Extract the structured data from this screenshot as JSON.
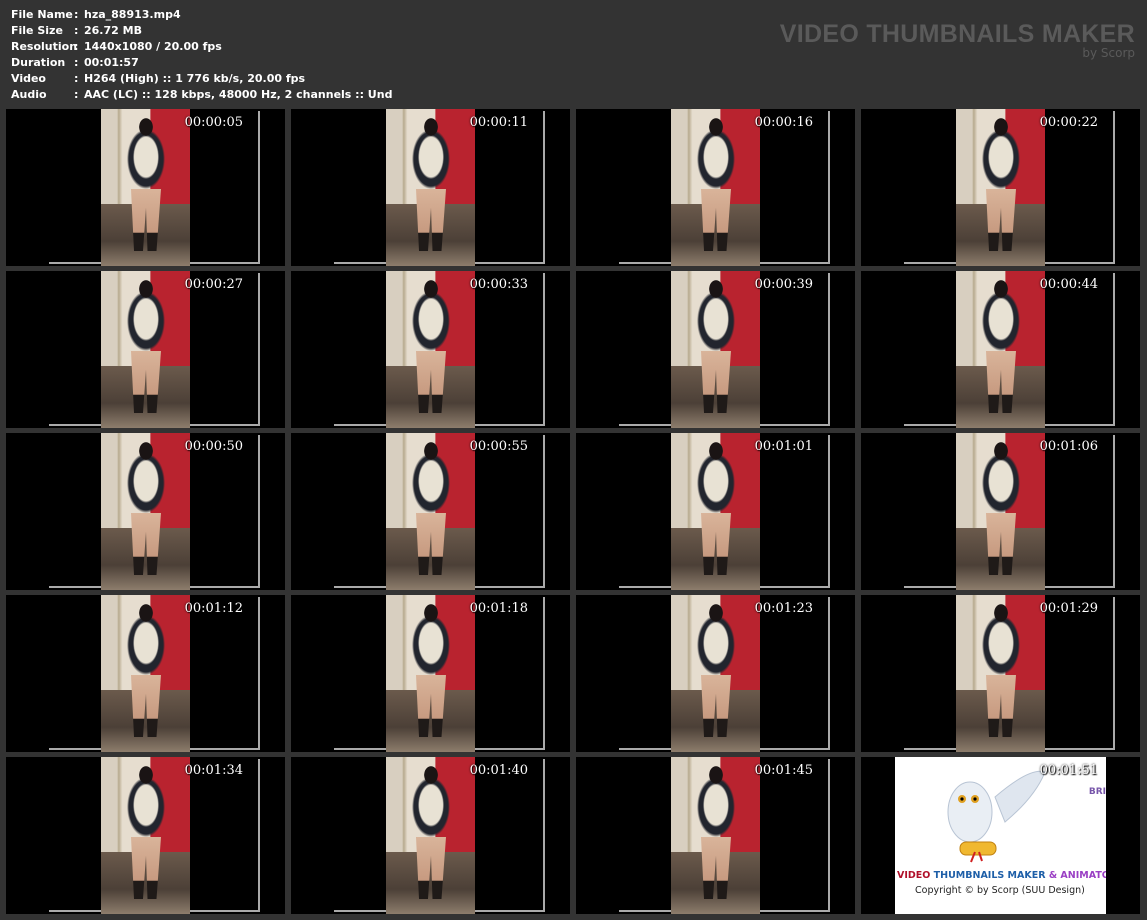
{
  "info": [
    {
      "label": "File Name",
      "value": "hza_88913.mp4"
    },
    {
      "label": "File Size",
      "value": "26.72 MB"
    },
    {
      "label": "Resolution",
      "value": "1440x1080 / 20.00 fps"
    },
    {
      "label": "Duration",
      "value": "00:01:57"
    },
    {
      "label": "Video",
      "value": "H264 (High) :: 1 776 kb/s, 20.00 fps"
    },
    {
      "label": "Audio",
      "value": "AAC (LC) :: 128 kbps, 48000 Hz, 2 channels :: Und"
    }
  ],
  "brand": {
    "title": "VIDEO THUMBNAILS MAKER",
    "byline": "by Scorp"
  },
  "thumbnails": [
    "00:00:05",
    "00:00:11",
    "00:00:16",
    "00:00:22",
    "00:00:27",
    "00:00:33",
    "00:00:39",
    "00:00:44",
    "00:00:50",
    "00:00:55",
    "00:01:01",
    "00:01:06",
    "00:01:12",
    "00:01:18",
    "00:01:23",
    "00:01:29",
    "00:01:34",
    "00:01:40",
    "00:01:45"
  ],
  "last_tile": {
    "timestamp": "00:01:51",
    "bri": "BRI",
    "title_parts": [
      {
        "text": "VIDEO ",
        "color": "#b0102a"
      },
      {
        "text": "THUMBNAILS MAKER ",
        "color": "#1e5fa8"
      },
      {
        "text": "& ANIMATO",
        "color": "#9a3fc4"
      }
    ],
    "copyright": "Copyright © by Scorp (SUU Design)"
  }
}
